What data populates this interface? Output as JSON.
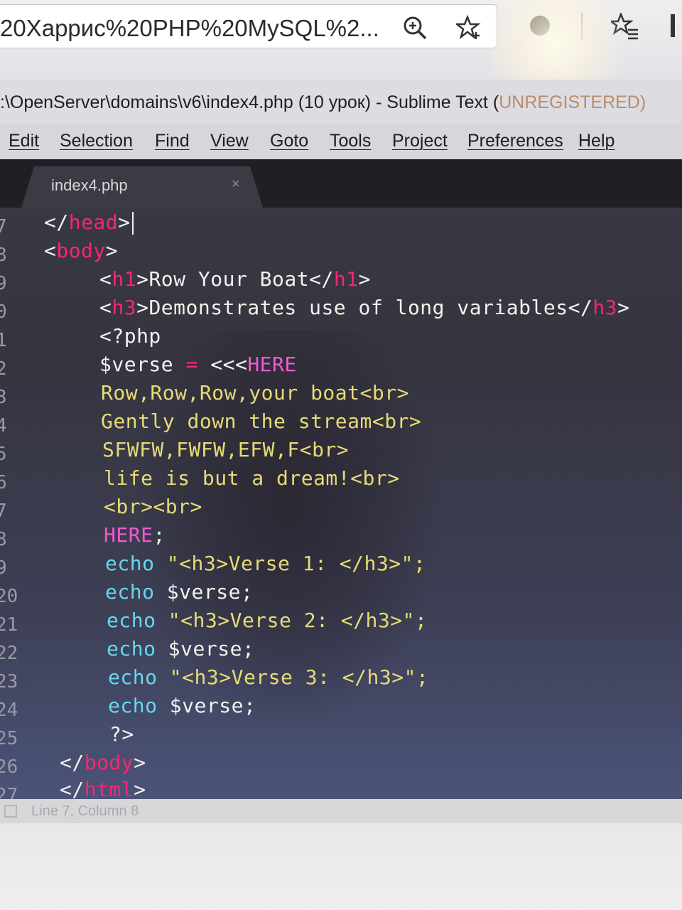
{
  "browser": {
    "address_text": "20Харрис%20PHP%20MySQL%2..."
  },
  "window": {
    "title_main": ":\\OpenServer\\domains\\v6\\index4.php (10 урок) - Sublime Text (",
    "title_faded": "UNREGISTERED)"
  },
  "menu": {
    "items": [
      "Edit",
      "Selection",
      "Find",
      "View",
      "Goto",
      "Tools",
      "Project",
      "Preferences",
      "Help"
    ]
  },
  "tab": {
    "label": "index4.php",
    "close": "×"
  },
  "gutter": {
    "numbers": [
      "7",
      "8",
      "9",
      "0",
      "1",
      "2",
      "3",
      "4",
      "5",
      "6",
      "7",
      "8",
      "9",
      "20",
      "21",
      "22",
      "23",
      "24",
      "25",
      "26",
      "27"
    ]
  },
  "code": {
    "lines": [
      "</head>",
      "<body>",
      "<h1>Row Your Boat</h1>",
      "<h3>Demonstrates use of long variables</h3>",
      "<?php",
      "$verse = <<<HERE",
      "Row,Row,Row,your boat<br>",
      "Gently down the stream<br>",
      "SFWFW,FWFW,EFW,F<br>",
      "life is but a dream!<br>",
      "<br><br>",
      "HERE;",
      "echo \"<h3>Verse 1: </h3>\";",
      "echo $verse;",
      "echo \"<h3>Verse 2: </h3>\";",
      "echo $verse;",
      "echo \"<h3>Verse 3: </h3>\";",
      "echo $verse;",
      "?>",
      "</body>",
      "</html>"
    ]
  },
  "status": {
    "text": "Line 7, Column 8"
  },
  "colors": {
    "tag": "#f92672",
    "keyword": "#66d9ef",
    "string": "#e6db74",
    "heredoc": "#f05ad0",
    "editor_bg": "#3a3a44"
  }
}
